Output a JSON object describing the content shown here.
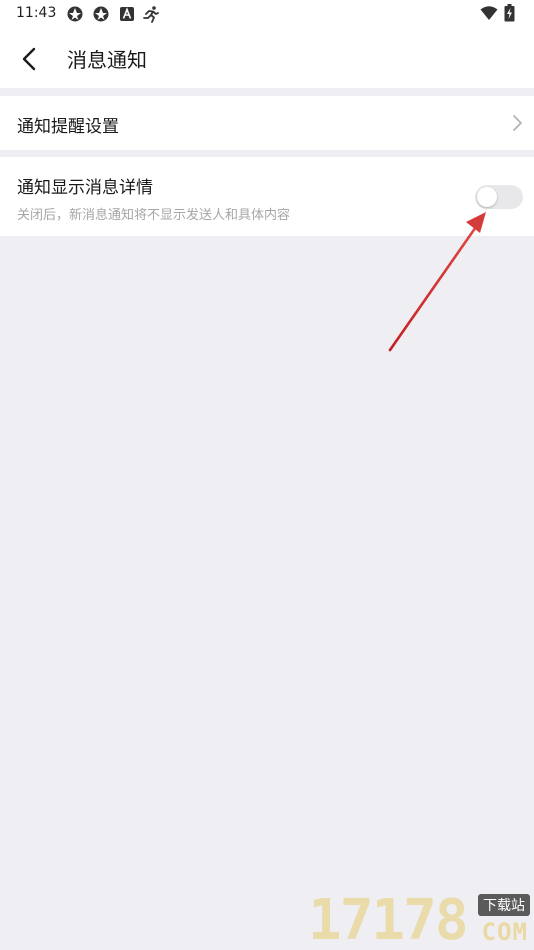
{
  "status_bar": {
    "time": "11:43",
    "left_icons": [
      "aperture-icon",
      "aperture-icon",
      "text-a-icon",
      "running-icon"
    ],
    "right_icons": [
      "wifi-icon",
      "battery-charging-icon"
    ]
  },
  "header": {
    "back_icon": "chevron-left-icon",
    "title": "消息通知"
  },
  "settings": {
    "reminder_row": {
      "label": "通知提醒设置"
    },
    "details_row": {
      "label": "通知显示消息详情",
      "sublabel": "关闭后，新消息通知将不显示发送人和具体内容",
      "toggle_on": false
    }
  },
  "annotation": {
    "arrow_color": "#d63b3b"
  },
  "watermark": {
    "digits": "17178",
    "badge": "下载站",
    "suffix": "COM"
  },
  "colors": {
    "background": "#efeef3",
    "surface": "#ffffff",
    "text_primary": "#1a1a1a",
    "text_secondary": "#a6a6a6",
    "toggle_off": "#e8e8ea"
  }
}
